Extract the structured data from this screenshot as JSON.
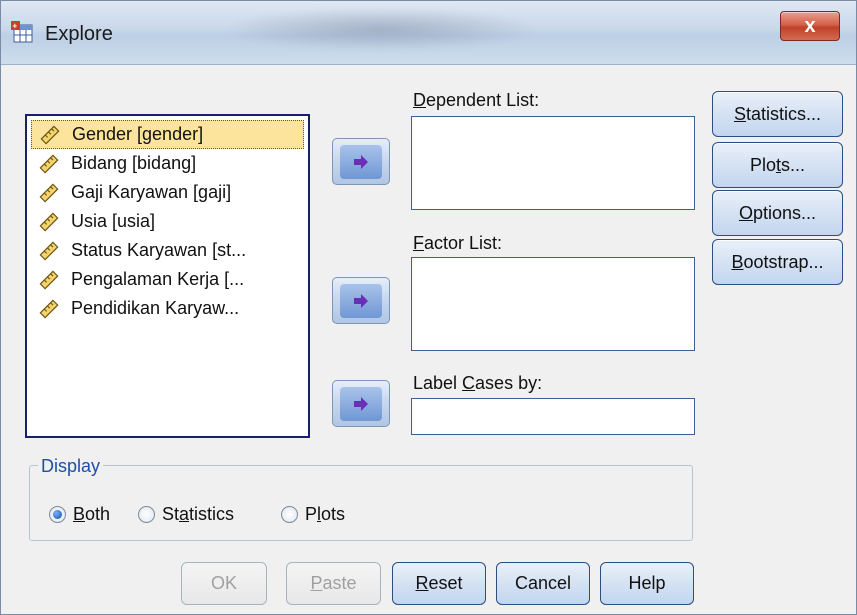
{
  "window": {
    "title": "Explore",
    "close_label": "x"
  },
  "variables": [
    {
      "label": "Gender [gender]",
      "icon": "scale-ruler-icon",
      "selected": true
    },
    {
      "label": "Bidang  [bidang]",
      "icon": "scale-ruler-icon",
      "selected": false
    },
    {
      "label": "Gaji Karyawan [gaji]",
      "icon": "scale-ruler-icon",
      "selected": false
    },
    {
      "label": "Usia [usia]",
      "icon": "scale-ruler-icon",
      "selected": false
    },
    {
      "label": "Status Karyawan [st...",
      "icon": "scale-ruler-icon",
      "selected": false
    },
    {
      "label": "Pengalaman Kerja [...",
      "icon": "scale-ruler-icon",
      "selected": false
    },
    {
      "label": "Pendidikan Karyaw...",
      "icon": "scale-ruler-icon",
      "selected": false
    }
  ],
  "fields": {
    "dependent_list": {
      "pre": "",
      "mnemonic": "D",
      "post": "ependent List:"
    },
    "factor_list": {
      "pre": "",
      "mnemonic": "F",
      "post": "actor List:"
    },
    "label_cases": {
      "pre": "Label ",
      "mnemonic": "C",
      "post": "ases by:"
    }
  },
  "side_buttons": {
    "statistics": {
      "pre": "",
      "mnemonic": "S",
      "post": "tatistics..."
    },
    "plots": {
      "pre": "Plo",
      "mnemonic": "t",
      "post": "s..."
    },
    "options": {
      "pre": "",
      "mnemonic": "O",
      "post": "ptions..."
    },
    "bootstrap": {
      "pre": "",
      "mnemonic": "B",
      "post": "ootstrap..."
    }
  },
  "display": {
    "legend": "Display",
    "selected": "Both",
    "options": {
      "both": {
        "pre": "",
        "mnemonic": "B",
        "post": "oth"
      },
      "statistics": {
        "pre": "St",
        "mnemonic": "a",
        "post": "tistics"
      },
      "plots": {
        "pre": "P",
        "mnemonic": "l",
        "post": "ots"
      }
    }
  },
  "bottom_buttons": {
    "ok": {
      "pre": "OK",
      "mnemonic": "",
      "post": "",
      "enabled": false
    },
    "paste": {
      "pre": "",
      "mnemonic": "P",
      "post": "aste",
      "enabled": false
    },
    "reset": {
      "pre": "",
      "mnemonic": "R",
      "post": "eset",
      "enabled": true
    },
    "cancel": {
      "pre": "Cancel",
      "mnemonic": "",
      "post": "",
      "enabled": true
    },
    "help": {
      "pre": "Help",
      "mnemonic": "",
      "post": "",
      "enabled": true
    }
  },
  "colors": {
    "selection": "#fce49d",
    "accent_blue": "#1f4fa8",
    "close_red": "#c0412a"
  }
}
